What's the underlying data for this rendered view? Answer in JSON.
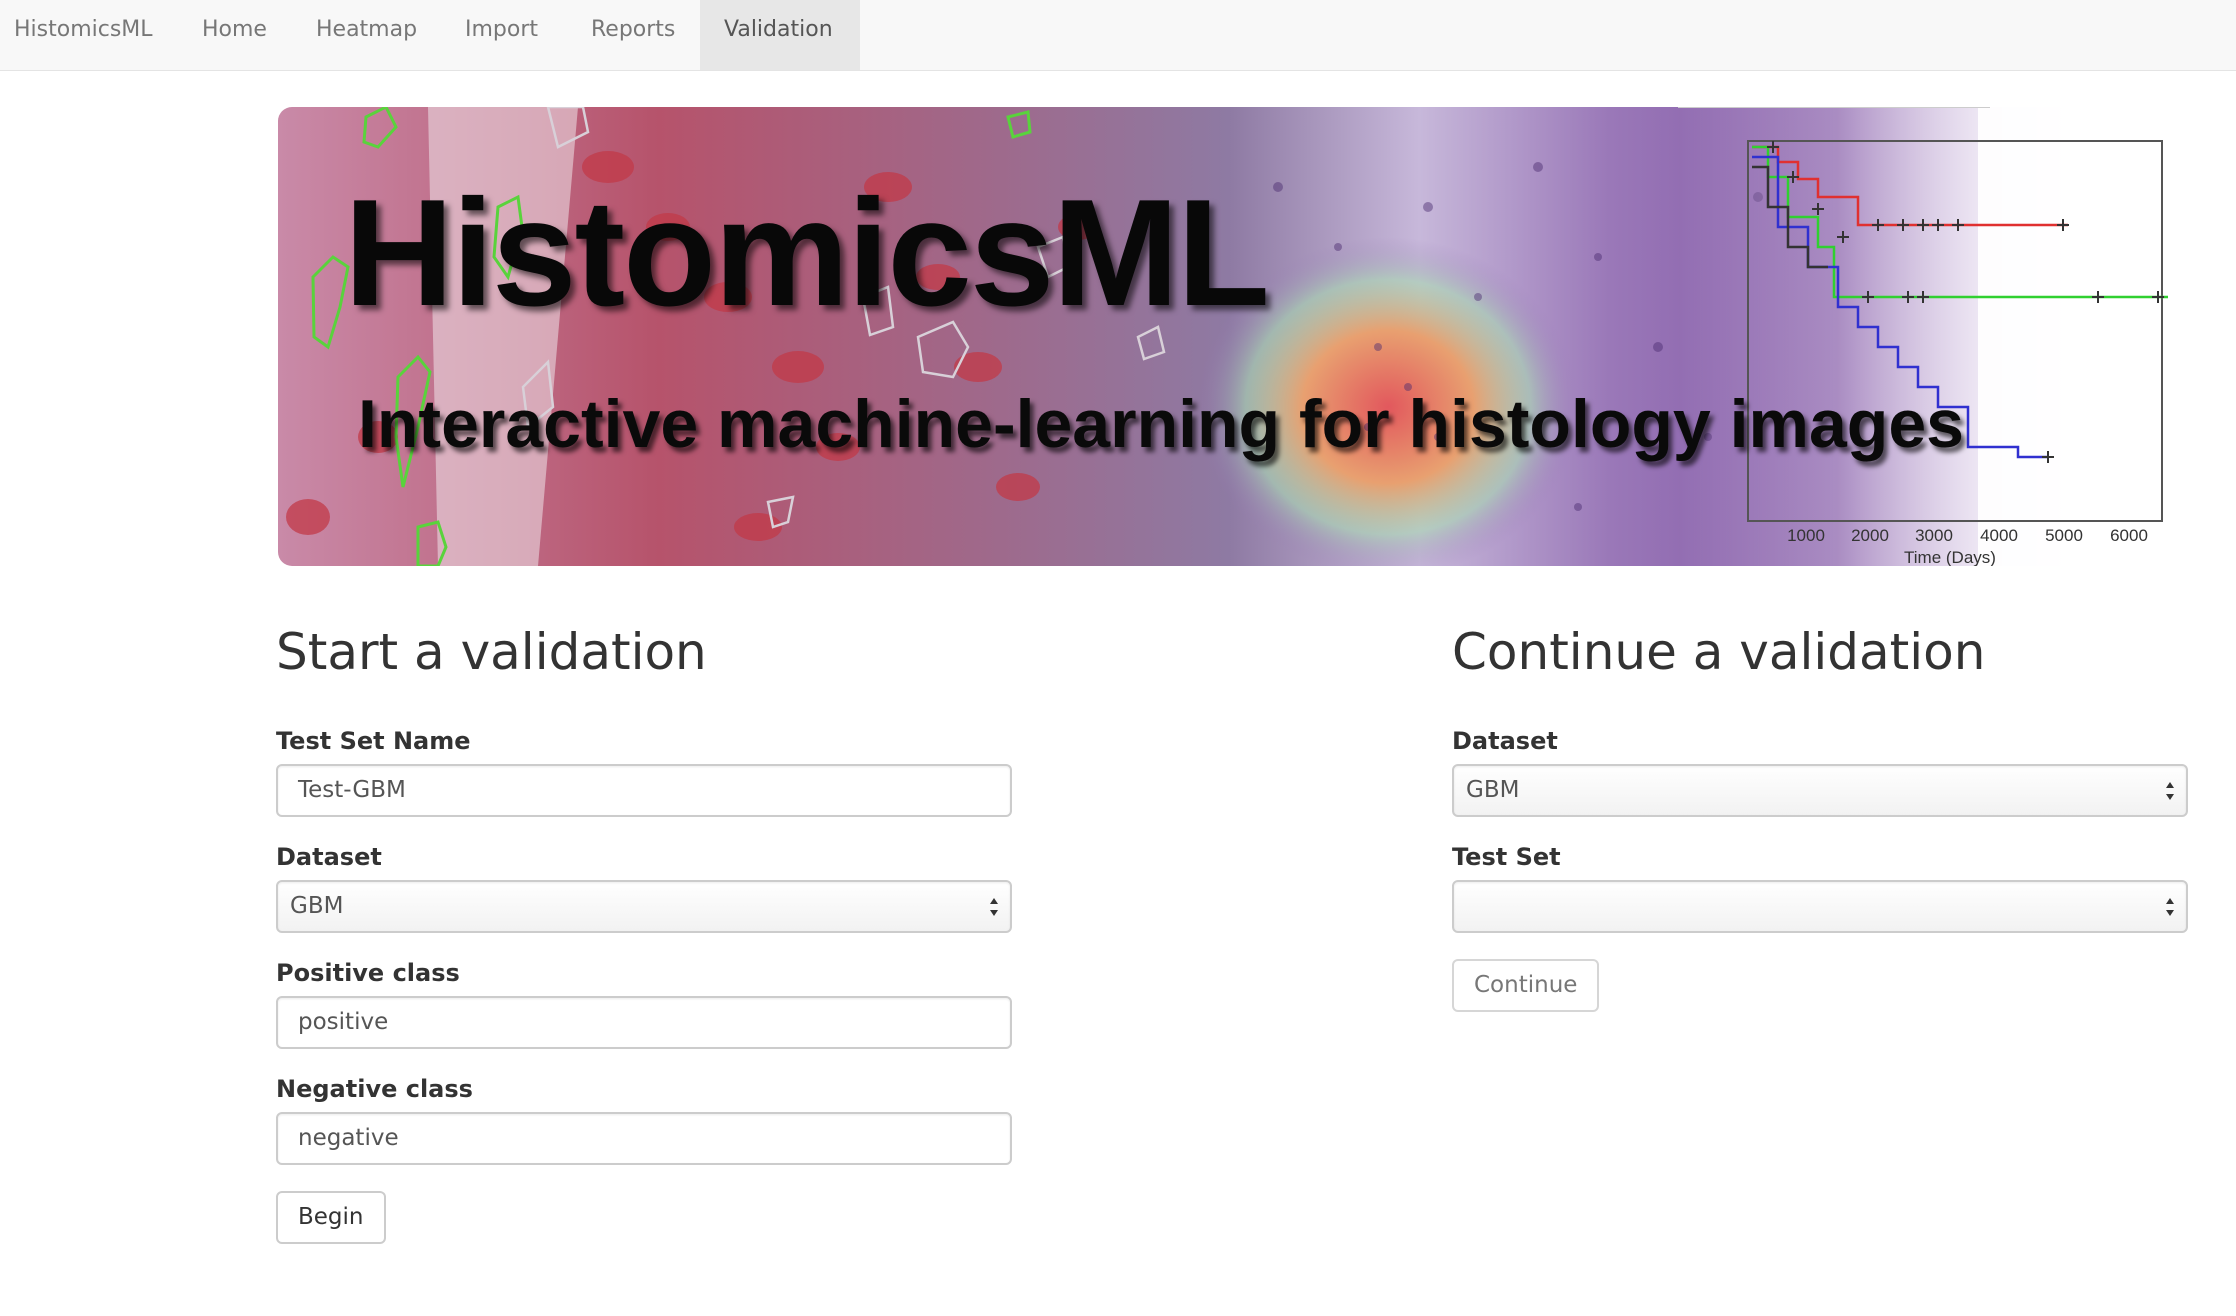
{
  "nav": {
    "brand": "HistomicsML",
    "items": [
      {
        "label": "Home"
      },
      {
        "label": "Heatmap"
      },
      {
        "label": "Import"
      },
      {
        "label": "Reports"
      },
      {
        "label": "Validation",
        "active": true
      }
    ]
  },
  "banner": {
    "title": "HistomicsML",
    "subtitle": "Interactive machine-learning for histology images",
    "plot": {
      "x_ticks": [
        "1000",
        "2000",
        "3000",
        "4000",
        "5000",
        "6000"
      ],
      "x_label": "Time (Days)",
      "series_colors": [
        "#e03030",
        "#30d030",
        "#3030d0",
        "#333333"
      ]
    }
  },
  "start_validation": {
    "title": "Start a validation",
    "test_set_name": {
      "label": "Test Set Name",
      "value": "Test-GBM"
    },
    "dataset": {
      "label": "Dataset",
      "value": "GBM"
    },
    "positive_class": {
      "label": "Positive class",
      "value": "positive"
    },
    "negative_class": {
      "label": "Negative class",
      "value": "negative"
    },
    "begin_button": "Begin"
  },
  "continue_validation": {
    "title": "Continue a validation",
    "dataset": {
      "label": "Dataset",
      "value": "GBM"
    },
    "test_set": {
      "label": "Test Set",
      "value": ""
    },
    "continue_button": "Continue"
  },
  "colors": {
    "navbar_bg": "#f8f8f8",
    "nav_active_bg": "#e7e7e7",
    "text": "#333333"
  }
}
